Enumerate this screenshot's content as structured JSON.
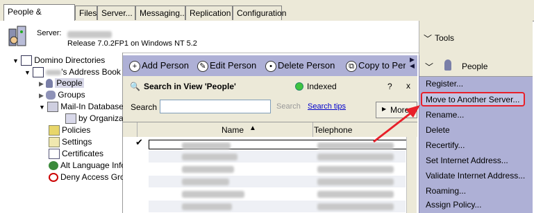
{
  "tabs": [
    "People & Groups",
    "Files",
    "Server...",
    "Messaging...",
    "Replication",
    "Configuration"
  ],
  "header": {
    "server_label": "Server:",
    "release": "Release 7.0.2FP1 on Windows NT 5.2",
    "tools_label": "Tools"
  },
  "tree": {
    "root": "Domino Directories",
    "address_book": "'s Address Book",
    "items": [
      "People",
      "Groups",
      "Mail-In Databases",
      "by Organizati",
      "Policies",
      "Settings",
      "Certificates",
      "Alt Language Info",
      "Deny Access Gro"
    ]
  },
  "actions": {
    "add": "Add Person",
    "edit": "Edit Person",
    "delete": "Delete Person",
    "copy": "Copy to Pers"
  },
  "search": {
    "title": "Search in View 'People'",
    "indexed": "Indexed",
    "help": "?",
    "close": "x",
    "label": "Search",
    "search_button": "Search",
    "tips": "Search tips",
    "more": "More"
  },
  "columns": {
    "name": "Name",
    "telephone": "Telephone"
  },
  "people_panel": {
    "title": "People",
    "items": [
      "Register...",
      "Move to Another Server...",
      "Rename...",
      "Delete",
      "Recertify...",
      "Set Internet Address...",
      "Validate Internet Address...",
      "Roaming...",
      "Assign Policy..."
    ]
  },
  "colors": {
    "highlight": "#e8202a",
    "panel": "#aeb0d6",
    "link": "#0000cc"
  }
}
